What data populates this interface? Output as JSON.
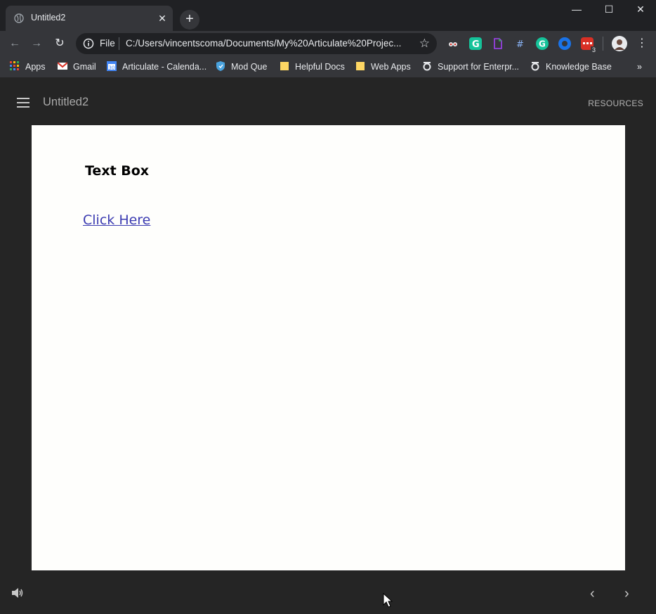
{
  "browser": {
    "tab_title": "Untitled2",
    "tab_close": "✕",
    "new_tab": "+",
    "window_controls": {
      "minimize": "—",
      "maximize": "☐",
      "close": "✕"
    },
    "omnibox": {
      "scheme_label": "File",
      "url": "C:/Users/vincentscoma/Documents/My%20Articulate%20Projec..."
    },
    "extension_badge": "3",
    "bookmarks": [
      {
        "label": "Apps",
        "icon": "apps-grid-icon"
      },
      {
        "label": "Gmail",
        "icon": "gmail-icon"
      },
      {
        "label": "Articulate - Calenda...",
        "icon": "calendar-icon"
      },
      {
        "label": "Mod Que",
        "icon": "shield-icon"
      },
      {
        "label": "Helpful Docs",
        "icon": "folder-icon"
      },
      {
        "label": "Web Apps",
        "icon": "folder-icon"
      },
      {
        "label": "Support for Enterpr...",
        "icon": "articulate-icon"
      },
      {
        "label": "Knowledge Base",
        "icon": "articulate-icon"
      }
    ],
    "bookmarks_overflow": "»"
  },
  "player": {
    "course_title": "Untitled2",
    "resources_label": "RESOURCES",
    "prev_label": "‹",
    "next_label": "›"
  },
  "slide": {
    "heading": "Text Box",
    "link_text": "Click Here"
  },
  "colors": {
    "chrome_bg": "#202124",
    "toolbar_bg": "#35363a",
    "player_bg": "#252525",
    "slide_bg": "#fefefc",
    "link": "#3b3bb1"
  }
}
